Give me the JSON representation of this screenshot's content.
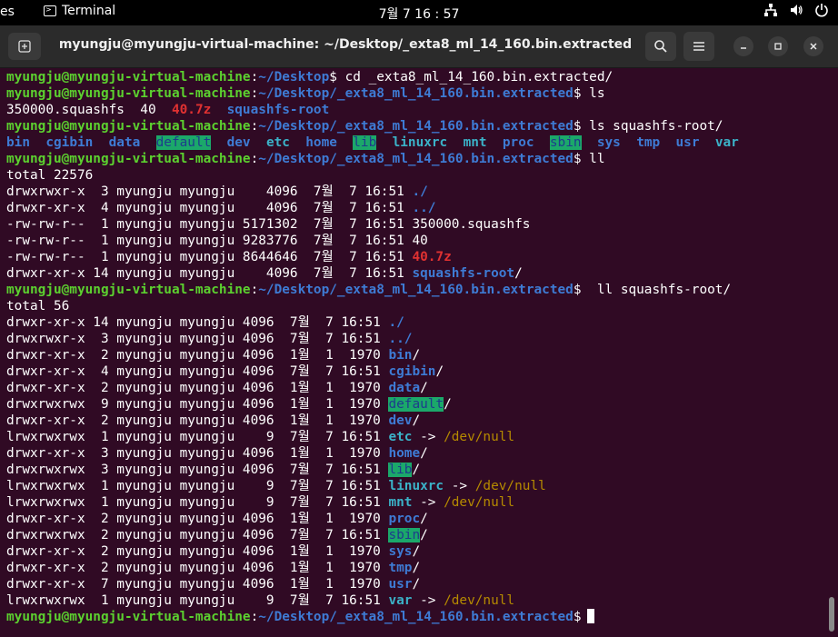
{
  "topbar": {
    "activities_partial": "es",
    "app_name": "Terminal",
    "clock": "7월 7  16 : 57"
  },
  "window": {
    "title": "myungju@myungju-virtual-machine: ~/Desktop/_exta8_ml_14_160.bin.extracted"
  },
  "icons": {
    "network": "network-icon",
    "volume": "volume-icon",
    "power": "power-icon",
    "new_tab": "new-tab-icon",
    "search": "search-icon",
    "menu": "hamburger-menu-icon",
    "minimize": "minimize-icon",
    "maximize": "maximize-icon",
    "close": "close-icon"
  },
  "colors": {
    "terminal_bg": "#300a24",
    "user_green": "#5cd12f",
    "path_blue": "#3e7bd4",
    "archive_red": "#e03131",
    "link_cyan": "#3bb2c8",
    "sticky_bg": "#1ba86a",
    "link_target": "#b58a00"
  },
  "prompt": {
    "user": "myungju@myungju-virtual-machine",
    "sep": ":",
    "path_desktop": "~/Desktop",
    "path_extracted": "~/Desktop/_exta8_ml_14_160.bin.extracted",
    "sym": "$"
  },
  "terminal": {
    "cmd1": " cd _exta8_ml_14_160.bin.extracted/",
    "cmd2": " ls",
    "ls1": {
      "a": "350000.squashfs  40  ",
      "b": "40.7z",
      "c": "  ",
      "d": "squashfs-root"
    },
    "cmd3": " ls squashfs-root/",
    "ls2": [
      {
        "t": "bin",
        "s": "d"
      },
      {
        "t": "cgibin",
        "s": "d"
      },
      {
        "t": "data",
        "s": "d"
      },
      {
        "t": "default",
        "s": "g"
      },
      {
        "t": "dev",
        "s": "d"
      },
      {
        "t": "etc",
        "s": "lk"
      },
      {
        "t": "home",
        "s": "d"
      },
      {
        "t": "lib",
        "s": "g"
      },
      {
        "t": "linuxrc",
        "s": "lk"
      },
      {
        "t": "mnt",
        "s": "lk"
      },
      {
        "t": "proc",
        "s": "d"
      },
      {
        "t": "sbin",
        "s": "g"
      },
      {
        "t": "sys",
        "s": "d"
      },
      {
        "t": "tmp",
        "s": "d"
      },
      {
        "t": "usr",
        "s": "d"
      },
      {
        "t": "var",
        "s": "lk"
      }
    ],
    "cmd4": " ll",
    "total1": "total 22576",
    "list1": [
      {
        "m": "drwxrwxr-x  3 myungju myungju    4096  7월  7 16:51 ",
        "n": "./",
        "s": "d",
        "sf": ""
      },
      {
        "m": "drwxr-xr-x  4 myungju myungju    4096  7월  7 16:51 ",
        "n": "../",
        "s": "d",
        "sf": ""
      },
      {
        "m": "-rw-rw-r--  1 myungju myungju 5171302  7월  7 16:51 ",
        "n": "350000.squashfs",
        "s": "w",
        "sf": ""
      },
      {
        "m": "-rw-rw-r--  1 myungju myungju 9283776  7월  7 16:51 ",
        "n": "40",
        "s": "w",
        "sf": ""
      },
      {
        "m": "-rw-rw-r--  1 myungju myungju 8644646  7월  7 16:51 ",
        "n": "40.7z",
        "s": "r",
        "sf": ""
      },
      {
        "m": "drwxr-xr-x 14 myungju myungju    4096  7월  7 16:51 ",
        "n": "squashfs-root",
        "s": "d",
        "sf": "/"
      }
    ],
    "cmd5": "  ll squashfs-root/",
    "total2": "total 56",
    "list2": [
      {
        "m": "drwxr-xr-x 14 myungju myungju 4096  7월  7 16:51 ",
        "n": "./",
        "s": "d",
        "sf": "",
        "t": ""
      },
      {
        "m": "drwxrwxr-x  3 myungju myungju 4096  7월  7 16:51 ",
        "n": "../",
        "s": "d",
        "sf": "",
        "t": ""
      },
      {
        "m": "drwxr-xr-x  2 myungju myungju 4096  1월  1  1970 ",
        "n": "bin",
        "s": "d",
        "sf": "/",
        "t": ""
      },
      {
        "m": "drwxr-xr-x  4 myungju myungju 4096  7월  7 16:51 ",
        "n": "cgibin",
        "s": "d",
        "sf": "/",
        "t": ""
      },
      {
        "m": "drwxr-xr-x  2 myungju myungju 4096  1월  1  1970 ",
        "n": "data",
        "s": "d",
        "sf": "/",
        "t": ""
      },
      {
        "m": "drwxrwxrwx  9 myungju myungju 4096  1월  1  1970 ",
        "n": "default",
        "s": "g",
        "sf": "/",
        "t": ""
      },
      {
        "m": "drwxr-xr-x  2 myungju myungju 4096  1월  1  1970 ",
        "n": "dev",
        "s": "d",
        "sf": "/",
        "t": ""
      },
      {
        "m": "lrwxrwxrwx  1 myungju myungju    9  7월  7 16:51 ",
        "n": "etc",
        "s": "lk",
        "sf": " -> ",
        "t": "/dev/null"
      },
      {
        "m": "drwxr-xr-x  3 myungju myungju 4096  1월  1  1970 ",
        "n": "home",
        "s": "d",
        "sf": "/",
        "t": ""
      },
      {
        "m": "drwxrwxrwx  3 myungju myungju 4096  7월  7 16:51 ",
        "n": "lib",
        "s": "g",
        "sf": "/",
        "t": ""
      },
      {
        "m": "lrwxrwxrwx  1 myungju myungju    9  7월  7 16:51 ",
        "n": "linuxrc",
        "s": "lk",
        "sf": " -> ",
        "t": "/dev/null"
      },
      {
        "m": "lrwxrwxrwx  1 myungju myungju    9  7월  7 16:51 ",
        "n": "mnt",
        "s": "lk",
        "sf": " -> ",
        "t": "/dev/null"
      },
      {
        "m": "drwxr-xr-x  2 myungju myungju 4096  1월  1  1970 ",
        "n": "proc",
        "s": "d",
        "sf": "/",
        "t": ""
      },
      {
        "m": "drwxrwxrwx  2 myungju myungju 4096  7월  7 16:51 ",
        "n": "sbin",
        "s": "g",
        "sf": "/",
        "t": ""
      },
      {
        "m": "drwxr-xr-x  2 myungju myungju 4096  1월  1  1970 ",
        "n": "sys",
        "s": "d",
        "sf": "/",
        "t": ""
      },
      {
        "m": "drwxr-xr-x  2 myungju myungju 4096  1월  1  1970 ",
        "n": "tmp",
        "s": "d",
        "sf": "/",
        "t": ""
      },
      {
        "m": "drwxr-xr-x  7 myungju myungju 4096  1월  1  1970 ",
        "n": "usr",
        "s": "d",
        "sf": "/",
        "t": ""
      },
      {
        "m": "lrwxrwxrwx  1 myungju myungju    9  7월  7 16:51 ",
        "n": "var",
        "s": "lk",
        "sf": " -> ",
        "t": "/dev/null"
      }
    ]
  }
}
